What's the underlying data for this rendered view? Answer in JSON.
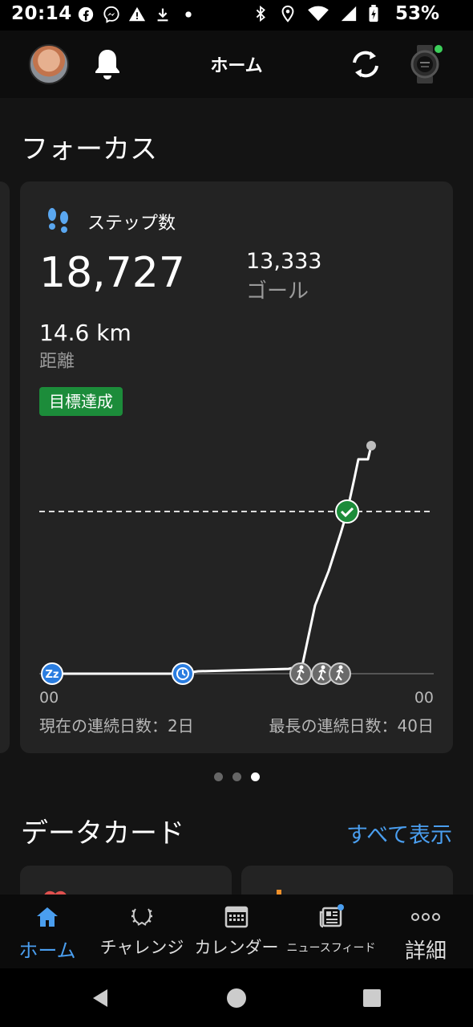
{
  "status_bar": {
    "time": "20:14",
    "battery": "53%",
    "left_icons": [
      "facebook-icon",
      "messenger-icon",
      "warning-icon",
      "download-icon",
      "dot-icon"
    ],
    "right_icons": [
      "bluetooth-icon",
      "location-icon",
      "wifi-icon",
      "signal-icon",
      "battery-icon"
    ]
  },
  "header": {
    "title": "ホーム"
  },
  "focus": {
    "section_title": "フォーカス",
    "card": {
      "title": "ステップ数",
      "steps": "18,727",
      "goal_value": "13,333",
      "goal_label": "ゴール",
      "distance_value": "14.6 km",
      "distance_label": "距離",
      "badge": "目標達成",
      "axis_start": "00",
      "axis_end": "00",
      "current_streak": "現在の連続日数：2日",
      "longest_streak": "最長の連続日数：40日",
      "timeline_icons": [
        "sleep-icon",
        "clock-icon",
        "walk-icon",
        "walk-icon",
        "walk-icon"
      ]
    },
    "pager": {
      "count": 3,
      "active": 2
    }
  },
  "datacards": {
    "section_title": "データカード",
    "see_all": "すべて表示"
  },
  "bottom_nav": {
    "items": [
      {
        "label": "ホーム",
        "icon": "home-icon",
        "active": true
      },
      {
        "label": "チャレンジ",
        "icon": "laurel-icon",
        "active": false
      },
      {
        "label": "カレンダー",
        "icon": "calendar-icon",
        "active": false
      },
      {
        "label": "ニュースフィード",
        "icon": "newsfeed-icon",
        "active": false
      },
      {
        "label": "詳細",
        "icon": "more-icon",
        "active": false
      }
    ]
  },
  "colors": {
    "accent": "#4a9eef",
    "goal_green": "#1c8c3a",
    "card_bg": "#232323"
  }
}
